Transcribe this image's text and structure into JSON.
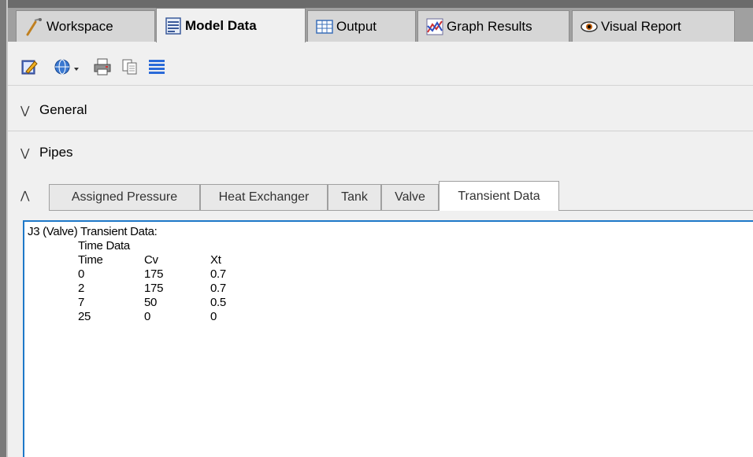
{
  "main_tabs": [
    {
      "label": "Workspace",
      "icon": "workspace-icon",
      "active": false
    },
    {
      "label": "Model Data",
      "icon": "model-data-icon",
      "active": true
    },
    {
      "label": "Output",
      "icon": "output-table-icon",
      "active": false
    },
    {
      "label": "Graph Results",
      "icon": "graph-icon",
      "active": false
    },
    {
      "label": "Visual Report",
      "icon": "eye-icon",
      "active": false
    }
  ],
  "toolbar": {
    "icons": [
      "edit-icon",
      "globe-dropdown-icon",
      "print-icon",
      "copy-icon",
      "list-icon"
    ]
  },
  "sections": [
    {
      "label": "General",
      "state": "collapsed"
    },
    {
      "label": "Pipes",
      "state": "collapsed"
    }
  ],
  "sub_tabs": [
    {
      "label": "Assigned Pressure",
      "active": false
    },
    {
      "label": "Heat Exchanger",
      "active": false
    },
    {
      "label": "Tank",
      "active": false
    },
    {
      "label": "Valve",
      "active": false
    },
    {
      "label": "Transient Data",
      "active": true
    }
  ],
  "transient": {
    "heading": "J3 (Valve) Transient Data:",
    "subheading": "Time Data",
    "columns": [
      "Time",
      "Cv",
      "Xt"
    ],
    "rows": [
      [
        "0",
        "175",
        "0.7"
      ],
      [
        "2",
        "175",
        "0.7"
      ],
      [
        "7",
        "50",
        "0.5"
      ],
      [
        "25",
        "0",
        "0"
      ]
    ]
  },
  "colors": {
    "accent_border": "#1e78c8",
    "tab_strip": "#a0a0a0"
  }
}
